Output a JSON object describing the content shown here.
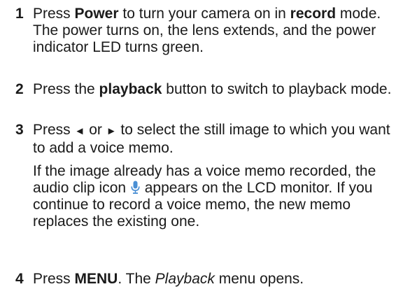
{
  "steps": [
    {
      "number": "1",
      "parts": [
        "Press ",
        "Power",
        " to turn your camera on in ",
        "record",
        " mode. The power turns on, the lens extends, and the power indicator LED turns green."
      ]
    },
    {
      "number": "2",
      "parts": [
        "Press the ",
        "playback",
        " button to switch to playback mode."
      ]
    },
    {
      "number": "3",
      "parts": [
        "Press ",
        "◄",
        " or ",
        "►",
        " to select the still image to which you want to add a voice memo."
      ],
      "note_parts": [
        "If the image already has a voice memo recorded, the audio clip icon ",
        " appears on the LCD monitor. If you continue to record a voice memo, the new memo replaces the existing one."
      ]
    },
    {
      "number": "4",
      "parts": [
        "Press ",
        "MENU",
        ". The ",
        "Playback",
        " menu opens."
      ]
    }
  ],
  "colors": {
    "text": "#1a1a1a",
    "mic_icon": "#4a8fd4"
  },
  "icons": {
    "audio_clip": "microphone-icon"
  }
}
